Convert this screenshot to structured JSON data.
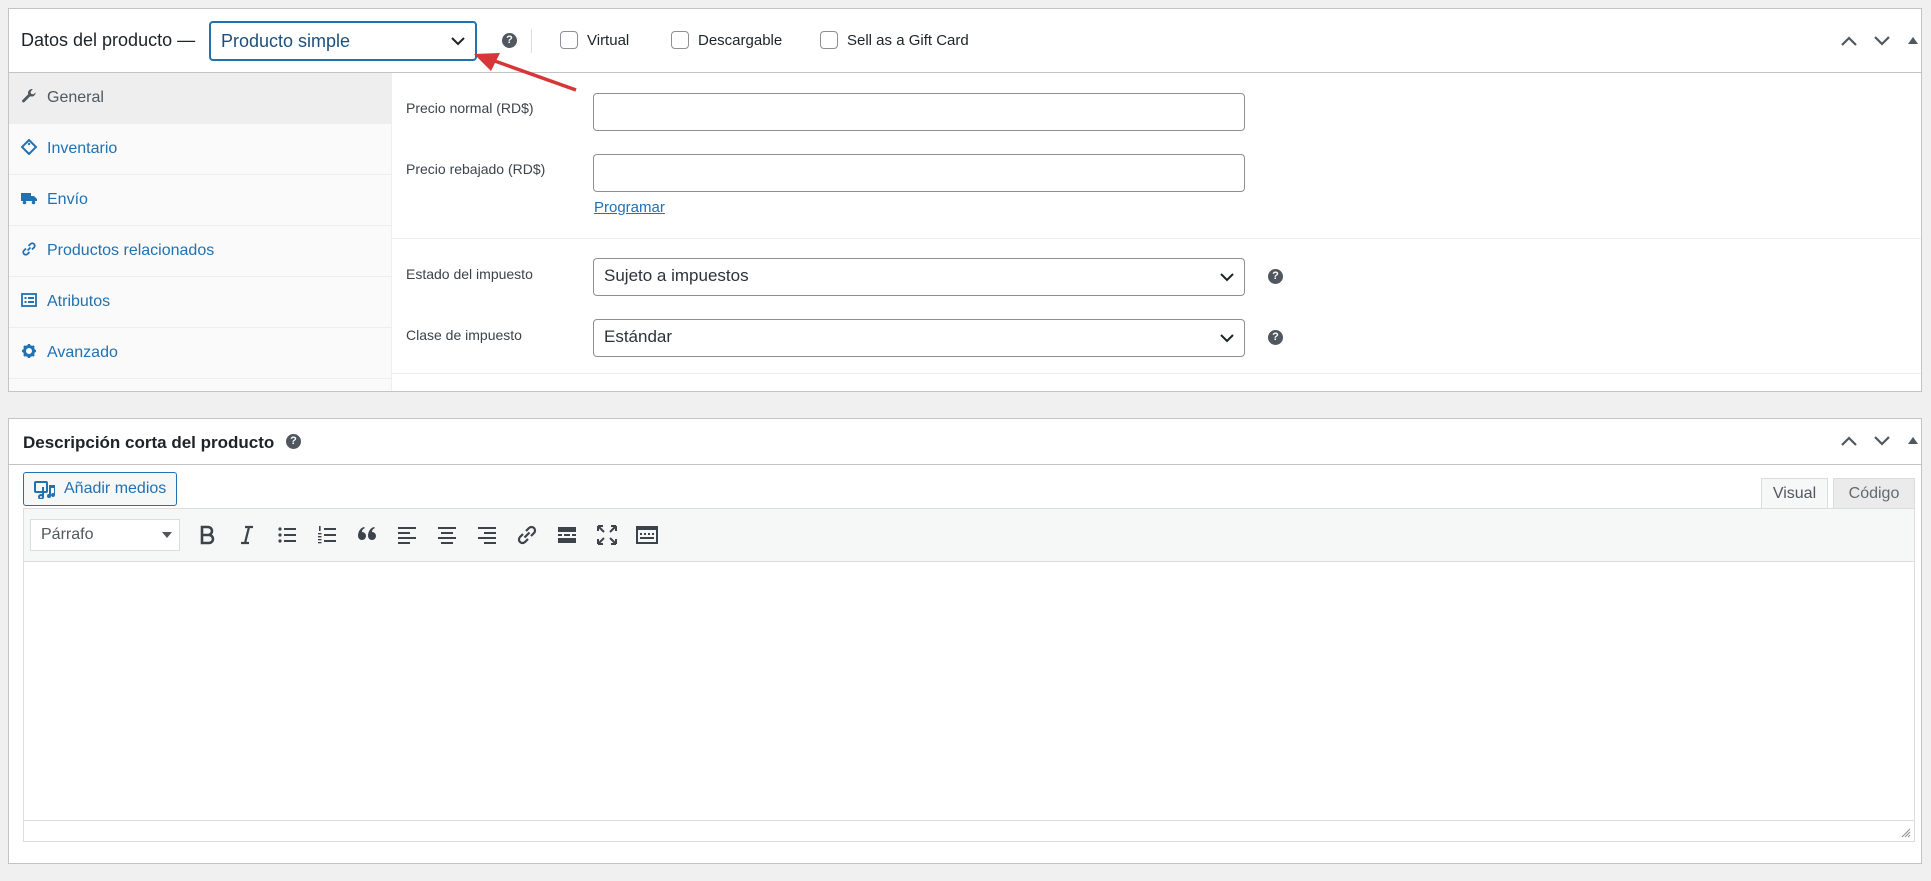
{
  "product_data": {
    "title": "Datos del producto —",
    "type_select": {
      "value": "Producto simple"
    },
    "checkboxes": [
      {
        "label": "Virtual",
        "checked": false
      },
      {
        "label": "Descargable",
        "checked": false
      },
      {
        "label": "Sell as a Gift Card",
        "checked": false
      }
    ],
    "tabs": [
      {
        "label": "General",
        "icon": "wrench-icon",
        "active": true
      },
      {
        "label": "Inventario",
        "icon": "tag-icon",
        "active": false
      },
      {
        "label": "Envío",
        "icon": "truck-icon",
        "active": false
      },
      {
        "label": "Productos relacionados",
        "icon": "link-icon",
        "active": false
      },
      {
        "label": "Atributos",
        "icon": "list-icon",
        "active": false
      },
      {
        "label": "Avanzado",
        "icon": "gear-icon",
        "active": false
      }
    ],
    "fields": {
      "regular_price_label": "Precio normal (RD$)",
      "regular_price_value": "",
      "sale_price_label": "Precio rebajado (RD$)",
      "sale_price_value": "",
      "schedule_link": "Programar",
      "tax_status_label": "Estado del impuesto",
      "tax_status_value": "Sujeto a impuestos",
      "tax_class_label": "Clase de impuesto",
      "tax_class_value": "Estándar"
    }
  },
  "short_description": {
    "title": "Descripción corta del producto",
    "add_media_label": "Añadir medios",
    "tab_visual": "Visual",
    "tab_code": "Código",
    "format_value": "Párrafo",
    "content": ""
  },
  "colors": {
    "accent": "#2271b1",
    "annotation_arrow": "#d63638"
  }
}
